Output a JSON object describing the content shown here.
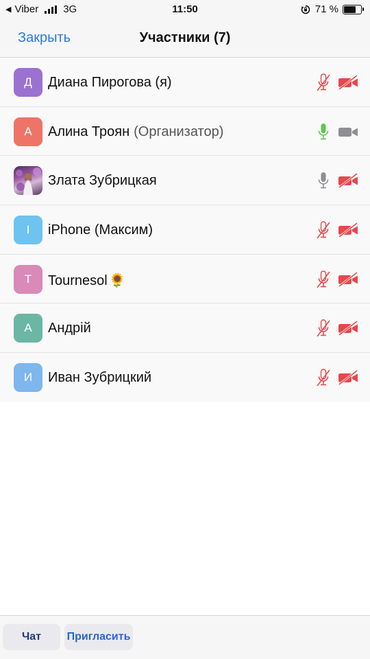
{
  "status_bar": {
    "back_app": "Viber",
    "network": "3G",
    "time": "11:50",
    "battery_percent_text": "71 %",
    "battery_level": 0.71
  },
  "navbar": {
    "close_label": "Закрыть",
    "title": "Участники (7)"
  },
  "participants": [
    {
      "initial": "Д",
      "name": "Диана Пирогова (я)",
      "role": "",
      "avatar_color": "#9b72d0",
      "mic": "muted",
      "camera": "off"
    },
    {
      "initial": "А",
      "name": "Алина Троян",
      "role": "(Организатор)",
      "avatar_color": "#ee7468",
      "mic": "active",
      "camera": "on"
    },
    {
      "initial": "",
      "name": "Злата Зубрицкая",
      "role": "",
      "avatar_color": "#7a4d8c",
      "avatar_type": "photo",
      "mic": "on",
      "camera": "off"
    },
    {
      "initial": "I",
      "name": "iPhone (Максим)",
      "role": "",
      "avatar_color": "#6ec3f0",
      "mic": "muted",
      "camera": "off"
    },
    {
      "initial": "T",
      "name": "Tournesol",
      "role": "",
      "emoji": "🌻",
      "avatar_color": "#d98ab8",
      "mic": "muted",
      "camera": "off"
    },
    {
      "initial": "А",
      "name": "Андрій",
      "role": "",
      "avatar_color": "#6cb6a4",
      "mic": "muted",
      "camera": "off"
    },
    {
      "initial": "И",
      "name": "Иван Зубрицкий",
      "role": "",
      "avatar_color": "#7eb6ee",
      "mic": "muted",
      "camera": "off"
    }
  ],
  "colors": {
    "accent": "#2a7ae2",
    "muted_red": "#e5484d",
    "active_green": "#5cc94a",
    "neutral_gray": "#8e8e93"
  },
  "bottom_bar": {
    "chat_label": "Чат",
    "invite_label": "Пригласить"
  }
}
